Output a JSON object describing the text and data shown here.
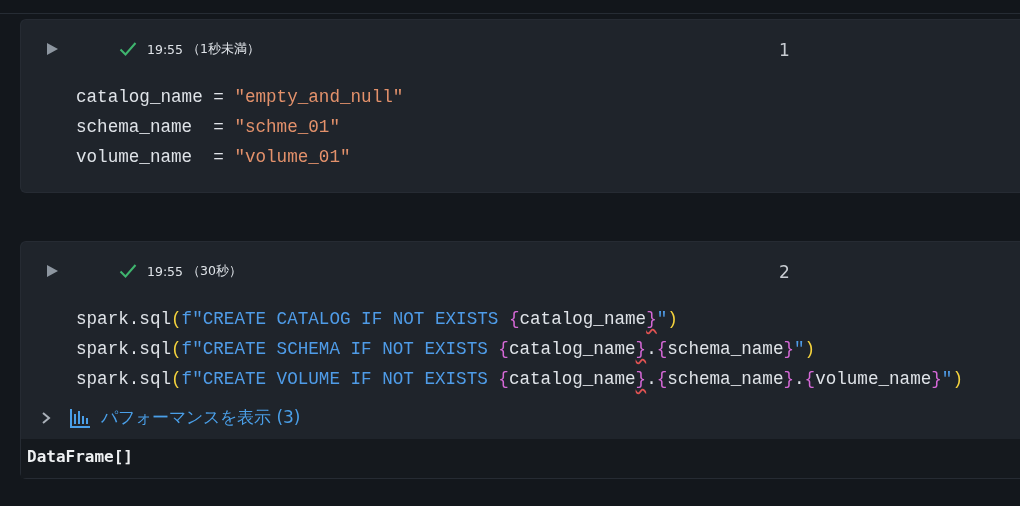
{
  "cells": [
    {
      "number": "1",
      "status": {
        "time": "19:55",
        "duration": "（1秒未満）"
      },
      "code": [
        [
          {
            "kind": "name",
            "text": "catalog_name"
          },
          {
            "kind": "op",
            "text": " = "
          },
          {
            "kind": "string",
            "text": "\"empty_and_null\""
          }
        ],
        [
          {
            "kind": "name",
            "text": "schema_name"
          },
          {
            "kind": "op",
            "text": "  = "
          },
          {
            "kind": "string",
            "text": "\"schme_01\""
          }
        ],
        [
          {
            "kind": "name",
            "text": "volume_name"
          },
          {
            "kind": "op",
            "text": "  = "
          },
          {
            "kind": "string",
            "text": "\"volume_01\""
          }
        ]
      ]
    },
    {
      "number": "2",
      "status": {
        "time": "19:55",
        "duration": "（30秒）"
      },
      "code": [
        [
          {
            "kind": "name",
            "text": "spark.sql"
          },
          {
            "kind": "paren",
            "text": "("
          },
          {
            "kind": "fstring",
            "text": "f\"CREATE CATALOG IF NOT EXISTS "
          },
          {
            "kind": "brace",
            "text": "{"
          },
          {
            "kind": "name",
            "text": "catalog_name"
          },
          {
            "kind": "brace_flagged",
            "text": "}"
          },
          {
            "kind": "fstring",
            "text": "\""
          },
          {
            "kind": "paren",
            "text": ")"
          }
        ],
        [
          {
            "kind": "name",
            "text": "spark.sql"
          },
          {
            "kind": "paren",
            "text": "("
          },
          {
            "kind": "fstring",
            "text": "f\"CREATE SCHEMA IF NOT EXISTS "
          },
          {
            "kind": "brace",
            "text": "{"
          },
          {
            "kind": "name",
            "text": "catalog_name"
          },
          {
            "kind": "brace_flagged",
            "text": "}"
          },
          {
            "kind": "name",
            "text": "."
          },
          {
            "kind": "brace",
            "text": "{"
          },
          {
            "kind": "name",
            "text": "schema_name"
          },
          {
            "kind": "brace",
            "text": "}"
          },
          {
            "kind": "fstring",
            "text": "\""
          },
          {
            "kind": "paren",
            "text": ")"
          }
        ],
        [
          {
            "kind": "name",
            "text": "spark.sql"
          },
          {
            "kind": "paren",
            "text": "("
          },
          {
            "kind": "fstring",
            "text": "f\"CREATE VOLUME IF NOT EXISTS "
          },
          {
            "kind": "brace",
            "text": "{"
          },
          {
            "kind": "name",
            "text": "catalog_name"
          },
          {
            "kind": "brace_flagged",
            "text": "}"
          },
          {
            "kind": "name",
            "text": "."
          },
          {
            "kind": "brace",
            "text": "{"
          },
          {
            "kind": "name",
            "text": "schema_name"
          },
          {
            "kind": "brace",
            "text": "}"
          },
          {
            "kind": "name",
            "text": "."
          },
          {
            "kind": "brace",
            "text": "{"
          },
          {
            "kind": "name",
            "text": "volume_name"
          },
          {
            "kind": "brace",
            "text": "}"
          },
          {
            "kind": "fstring",
            "text": "\""
          },
          {
            "kind": "paren",
            "text": ")"
          }
        ]
      ],
      "performance": {
        "label": "パフォーマンスを表示 (3)",
        "expanded": false
      },
      "output": "DataFrame[]"
    }
  ]
}
